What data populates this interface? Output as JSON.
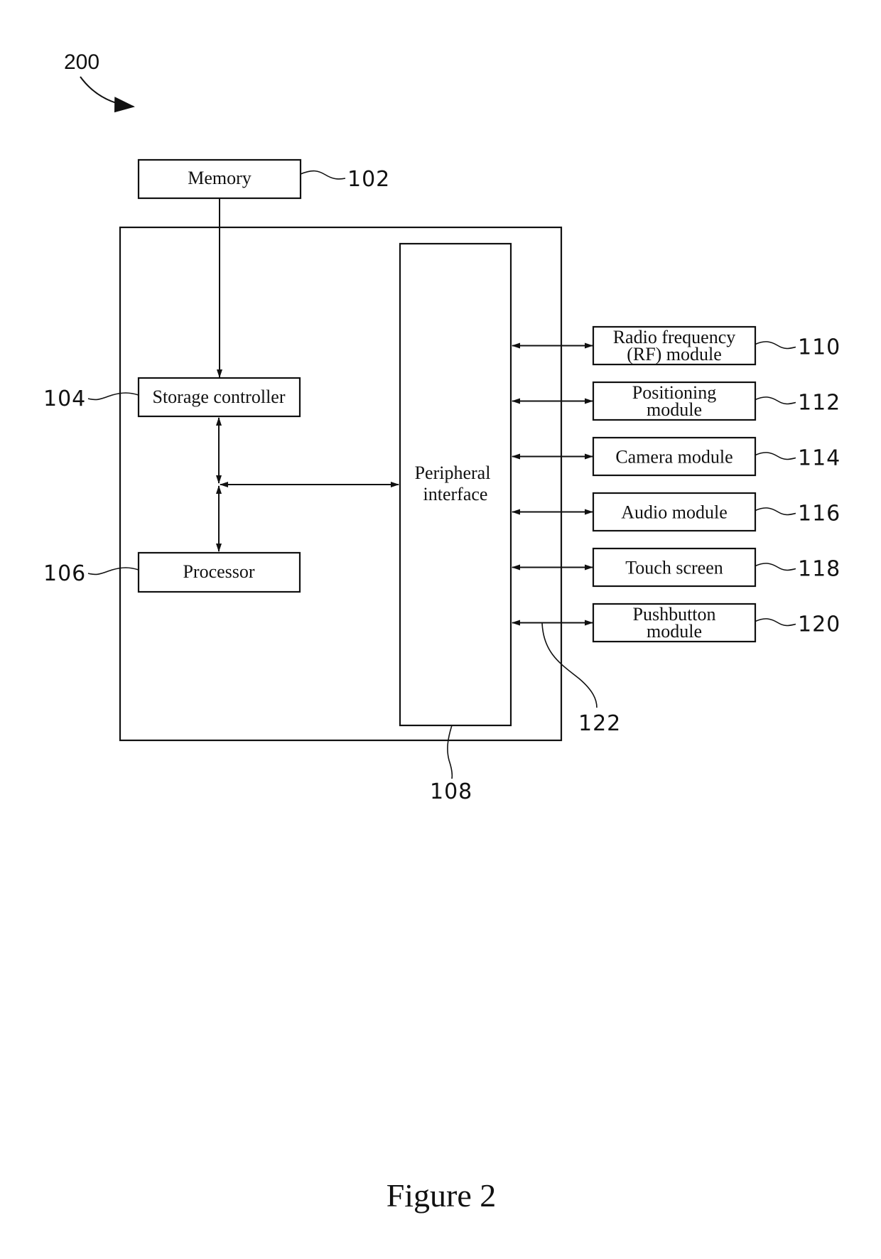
{
  "figure": {
    "number_label": "200",
    "caption": "Figure 2"
  },
  "blocks": {
    "memory": {
      "label": "Memory",
      "ref": "102"
    },
    "storage_controller": {
      "label": "Storage controller",
      "ref": "104"
    },
    "processor": {
      "label": "Processor",
      "ref": "106"
    },
    "peripheral_interface": {
      "lines": [
        "Peripheral",
        "interface"
      ],
      "ref": "108"
    }
  },
  "modules": [
    {
      "lines": [
        "Radio frequency",
        "(RF) module"
      ],
      "ref": "110"
    },
    {
      "lines": [
        "Positioning",
        "module"
      ],
      "ref": "112"
    },
    {
      "lines": [
        "Camera module"
      ],
      "ref": "114"
    },
    {
      "lines": [
        "Audio module"
      ],
      "ref": "116"
    },
    {
      "lines": [
        "Touch screen"
      ],
      "ref": "118"
    },
    {
      "lines": [
        "Pushbutton",
        "module"
      ],
      "ref": "120"
    }
  ],
  "bus_ref": "122"
}
